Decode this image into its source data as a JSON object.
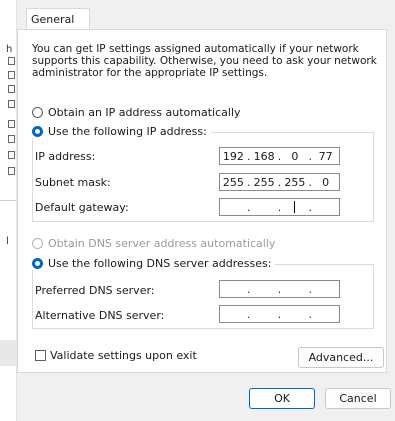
{
  "background_window": {
    "fragments": [
      "h",
      "l"
    ]
  },
  "dialog": {
    "tab_label": "General",
    "description": "You can get IP settings assigned automatically if your network supports this capability. Otherwise, you need to ask your network administrator for the appropriate IP settings.",
    "ip_mode": {
      "auto_label": "Obtain an IP address automatically",
      "manual_label": "Use the following IP address:",
      "selected": "manual"
    },
    "ip_fields": {
      "ip_address": {
        "label": "IP address:",
        "octets": [
          "192",
          "168",
          "0",
          "77"
        ]
      },
      "subnet_mask": {
        "label": "Subnet mask:",
        "octets": [
          "255",
          "255",
          "255",
          "0"
        ]
      },
      "default_gateway": {
        "label": "Default gateway:",
        "octets": [
          "",
          "",
          "",
          ""
        ]
      }
    },
    "dns_mode": {
      "auto_label": "Obtain DNS server address automatically",
      "manual_label": "Use the following DNS server addresses:",
      "selected": "manual",
      "auto_disabled": true
    },
    "dns_fields": {
      "preferred": {
        "label": "Preferred DNS server:",
        "octets": [
          "",
          "",
          "",
          ""
        ]
      },
      "alternative": {
        "label": "Alternative DNS server:",
        "octets": [
          "",
          "",
          "",
          ""
        ]
      }
    },
    "validate_label": "Validate settings upon exit",
    "validate_checked": false,
    "advanced_label": "Advanced...",
    "ok_label": "OK",
    "cancel_label": "Cancel"
  },
  "colors": {
    "accent": "#0067c0",
    "panel": "#ffffff",
    "dialog_bg": "#f0f0f0",
    "disabled_text": "#9a9a9a"
  }
}
